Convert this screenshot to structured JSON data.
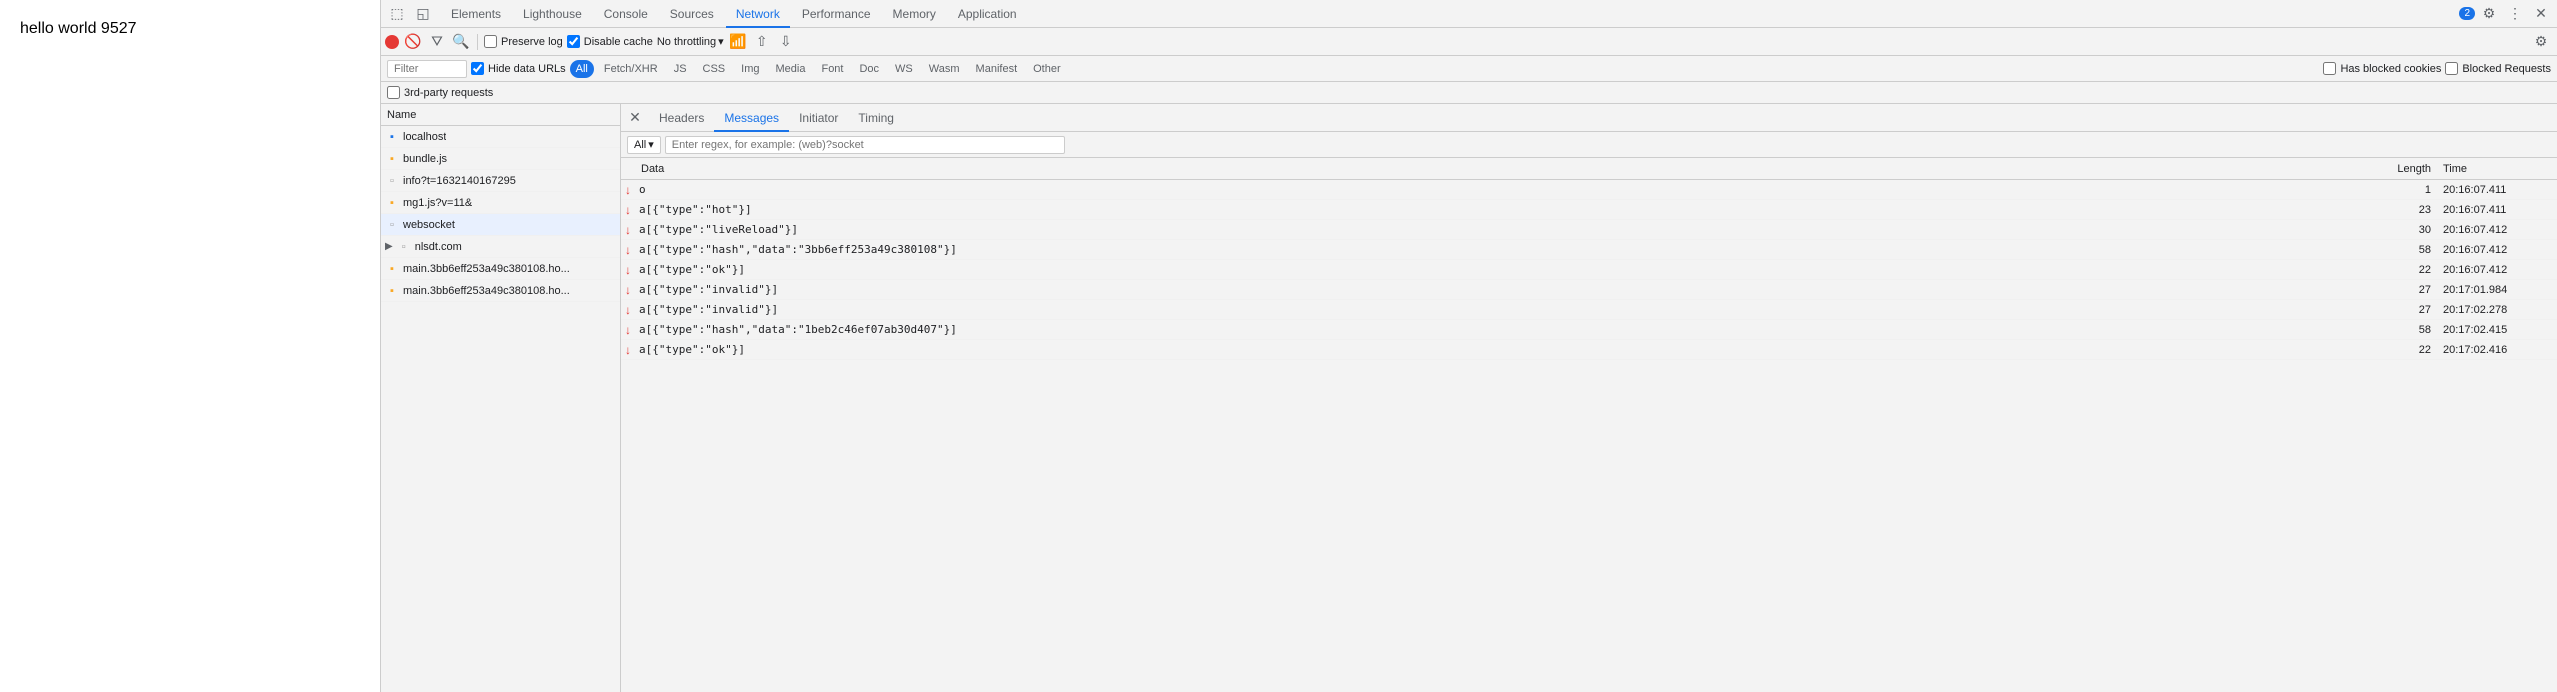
{
  "page": {
    "title": "hello world 9527"
  },
  "devtools": {
    "tabs": [
      {
        "label": "Elements",
        "active": false
      },
      {
        "label": "Lighthouse",
        "active": false
      },
      {
        "label": "Console",
        "active": false
      },
      {
        "label": "Sources",
        "active": false
      },
      {
        "label": "Network",
        "active": true
      },
      {
        "label": "Performance",
        "active": false
      },
      {
        "label": "Memory",
        "active": false
      },
      {
        "label": "Application",
        "active": false
      }
    ],
    "badge_count": "2",
    "network": {
      "toolbar": {
        "preserve_log_label": "Preserve log",
        "disable_cache_label": "Disable cache",
        "throttle_label": "No throttling",
        "preserve_log_checked": false,
        "disable_cache_checked": true
      },
      "filter": {
        "placeholder": "Filter",
        "hide_data_urls_label": "Hide data URLs",
        "hide_data_urls_checked": true,
        "types": [
          "All",
          "Fetch/XHR",
          "JS",
          "CSS",
          "Img",
          "Media",
          "Font",
          "Doc",
          "WS",
          "Wasm",
          "Manifest",
          "Other"
        ],
        "active_type": "All",
        "has_blocked_cookies_label": "Has blocked cookies",
        "blocked_requests_label": "Blocked Requests"
      },
      "third_party_label": "3rd-party requests"
    },
    "requests": {
      "column_name": "Name",
      "items": [
        {
          "name": "localhost",
          "type": "doc",
          "selected": false
        },
        {
          "name": "bundle.js",
          "type": "script",
          "selected": false
        },
        {
          "name": "info?t=1632140167295",
          "type": "other",
          "selected": false
        },
        {
          "name": "mg1.js?v=11&",
          "type": "script",
          "selected": false
        },
        {
          "name": "websocket",
          "type": "other",
          "selected": true
        },
        {
          "name": "nlsdt.com",
          "type": "group",
          "selected": false
        },
        {
          "name": "main.3bb6eff253a49c380108.ho...",
          "type": "script",
          "selected": false
        },
        {
          "name": "main.3bb6eff253a49c380108.ho...",
          "type": "script",
          "selected": false
        }
      ]
    },
    "details": {
      "tabs": [
        "Headers",
        "Messages",
        "Initiator",
        "Timing"
      ],
      "active_tab": "Messages",
      "messages_filter": {
        "select_label": "All",
        "search_placeholder": "Enter regex, for example: (web)?socket"
      },
      "messages_columns": {
        "data": "Data",
        "length": "Length",
        "time": "Time"
      },
      "messages": [
        {
          "direction": "down",
          "data": "o",
          "length": "1",
          "time": "20:16:07.411"
        },
        {
          "direction": "down",
          "data": "a[{\"type\":\"hot\"}]",
          "length": "23",
          "time": "20:16:07.411"
        },
        {
          "direction": "down",
          "data": "a[{\"type\":\"liveReload\"}]",
          "length": "30",
          "time": "20:16:07.412"
        },
        {
          "direction": "down",
          "data": "a[{\"type\":\"hash\",\"data\":\"3bb6eff253a49c380108\"}]",
          "length": "58",
          "time": "20:16:07.412"
        },
        {
          "direction": "down",
          "data": "a[{\"type\":\"ok\"}]",
          "length": "22",
          "time": "20:16:07.412"
        },
        {
          "direction": "down",
          "data": "a[{\"type\":\"invalid\"}]",
          "length": "27",
          "time": "20:17:01.984"
        },
        {
          "direction": "down",
          "data": "a[{\"type\":\"invalid\"}]",
          "length": "27",
          "time": "20:17:02.278"
        },
        {
          "direction": "down",
          "data": "a[{\"type\":\"hash\",\"data\":\"1beb2c46ef07ab30d407\"}]",
          "length": "58",
          "time": "20:17:02.415"
        },
        {
          "direction": "down",
          "data": "a[{\"type\":\"ok\"}]",
          "length": "22",
          "time": "20:17:02.416"
        }
      ]
    }
  }
}
